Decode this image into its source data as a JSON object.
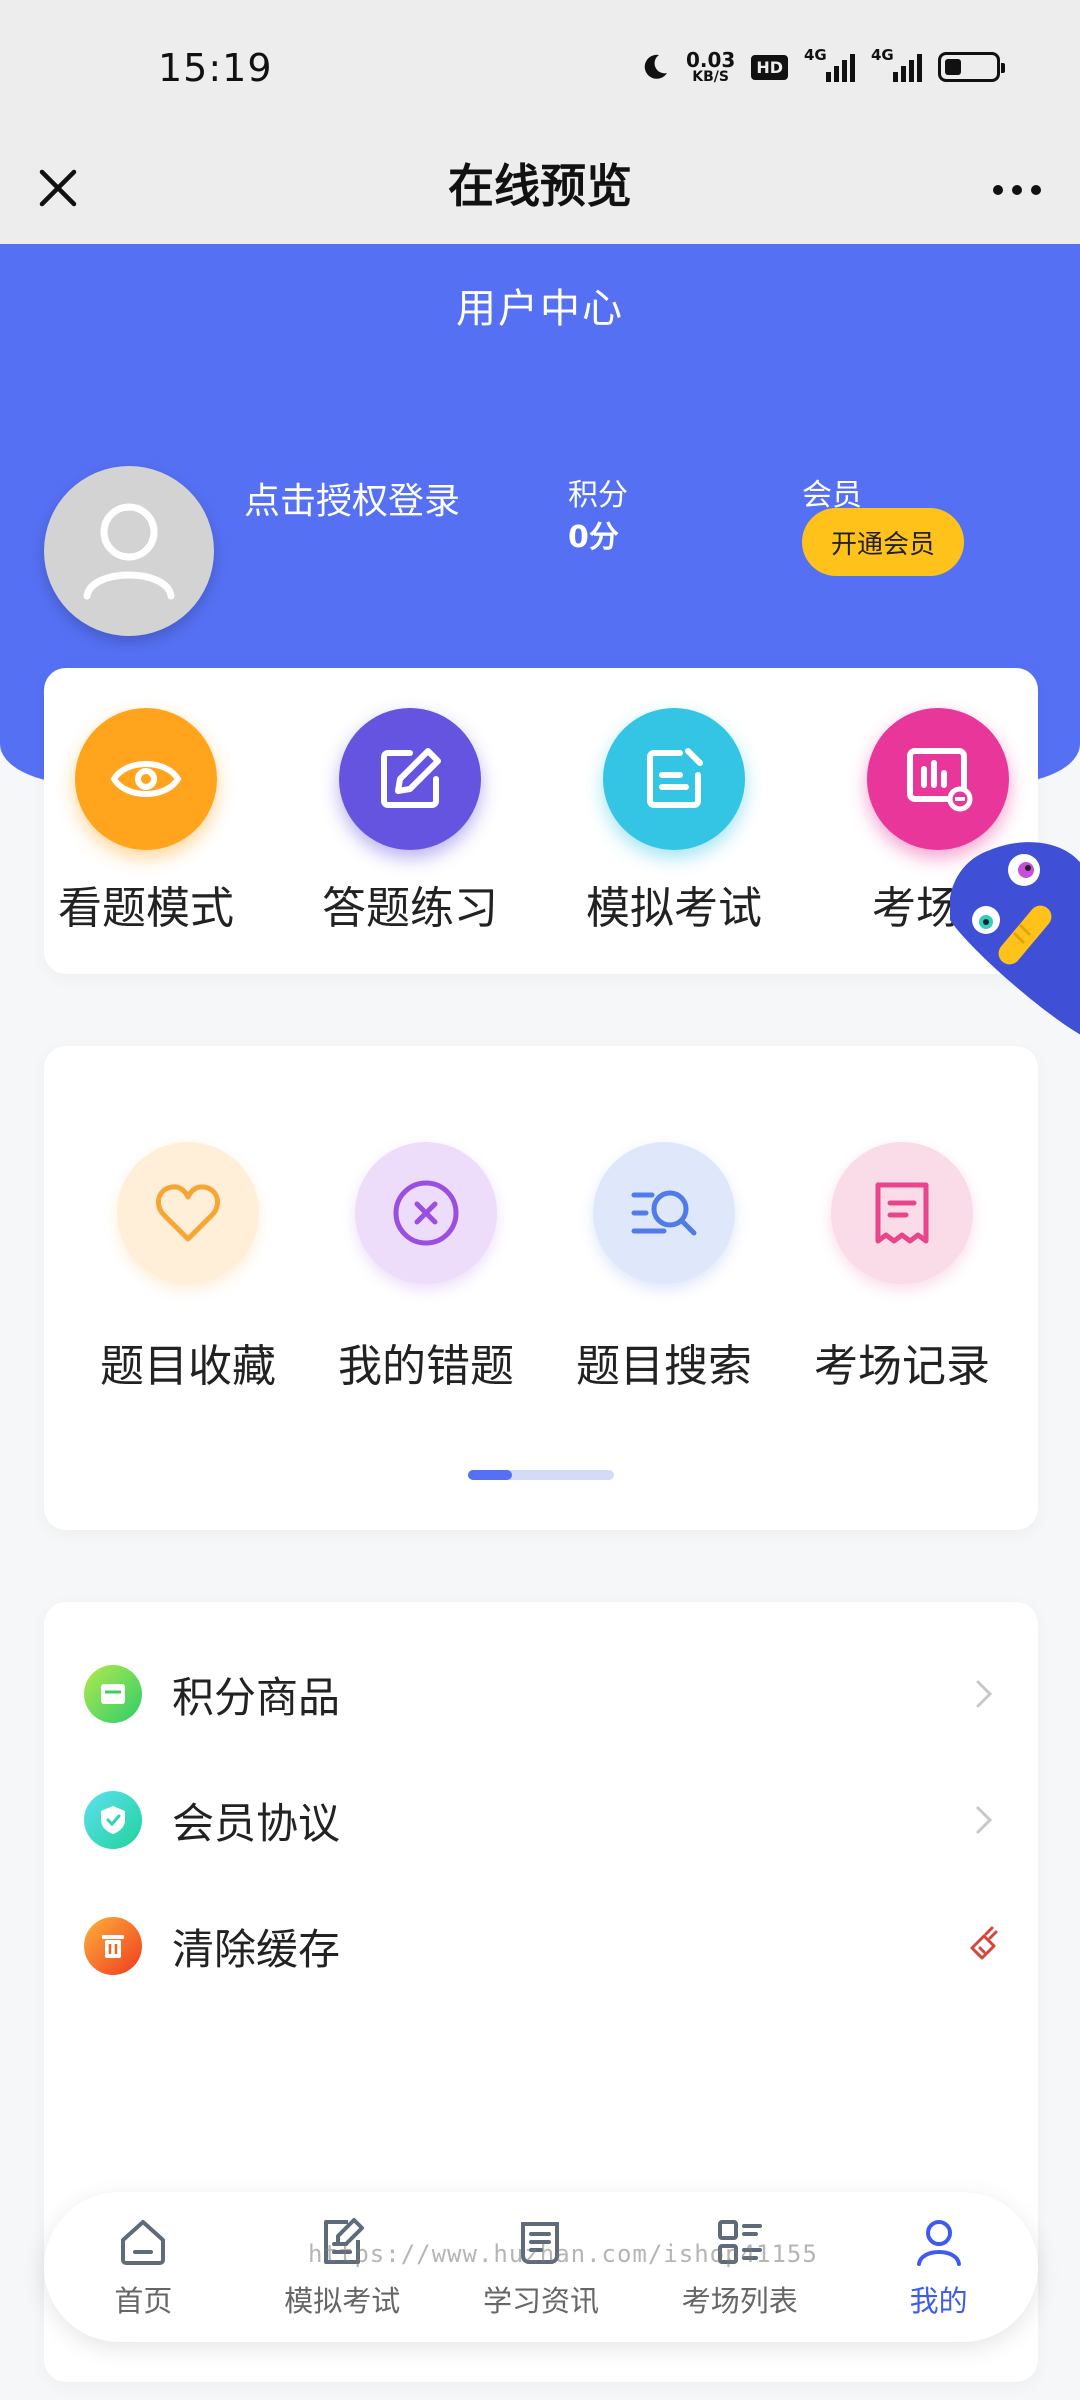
{
  "status_bar": {
    "time": "15:19",
    "net_speed_value": "0.03",
    "net_speed_unit": "KB/S",
    "hd_badge": "HD",
    "sim1_label": "4G",
    "sim2_label": "4G"
  },
  "nav": {
    "title": "在线预览"
  },
  "header": {
    "title": "用户中心",
    "login_text": "点击授权登录",
    "points_label": "积分",
    "points_value": "0分",
    "member_label": "会员",
    "member_button": "开通会员"
  },
  "top_menu": {
    "items": [
      {
        "label": "看题模式",
        "icon": "eye-icon",
        "color": "#ffa41c"
      },
      {
        "label": "答题练习",
        "icon": "edit-icon",
        "color": "#6554e0"
      },
      {
        "label": "模拟考试",
        "icon": "note-icon",
        "color": "#35c5e4"
      },
      {
        "label": "考场排",
        "icon": "chart-icon",
        "color": "#e8369a"
      }
    ]
  },
  "mid_menu": {
    "items": [
      {
        "label": "题目收藏",
        "icon": "heart-icon",
        "bg": "#ffefd8",
        "color": "#f5a634"
      },
      {
        "label": "我的错题",
        "icon": "close-circle-icon",
        "bg": "#eedcfb",
        "color": "#9b4fe0"
      },
      {
        "label": "题目搜索",
        "icon": "search-list-icon",
        "bg": "#dfe8fb",
        "color": "#4f7ce8"
      },
      {
        "label": "考场记录",
        "icon": "receipt-icon",
        "bg": "#fadbe8",
        "color": "#e8458a"
      }
    ],
    "page_index": 1,
    "page_count": 2
  },
  "list": {
    "items": [
      {
        "label": "积分商品",
        "icon": "shop-icon",
        "color": "#3ccf5c"
      },
      {
        "label": "会员协议",
        "icon": "shield-icon",
        "color": "#2fd5b8"
      },
      {
        "label": "清除缓存",
        "icon": "trash-icon",
        "color": "#f0621e"
      }
    ]
  },
  "tab_bar": {
    "items": [
      {
        "label": "首页",
        "icon": "home-icon"
      },
      {
        "label": "模拟考试",
        "icon": "exam-icon"
      },
      {
        "label": "学习资讯",
        "icon": "news-icon"
      },
      {
        "label": "考场列表",
        "icon": "list-icon"
      },
      {
        "label": "我的",
        "icon": "user-icon"
      }
    ],
    "active_index": 4,
    "active_color": "#3d5bf0"
  },
  "watermark": "https://www.huzhan.com/ishop41155",
  "colors": {
    "header_blue": "#5570f3",
    "member_yellow": "#ffc21a"
  }
}
